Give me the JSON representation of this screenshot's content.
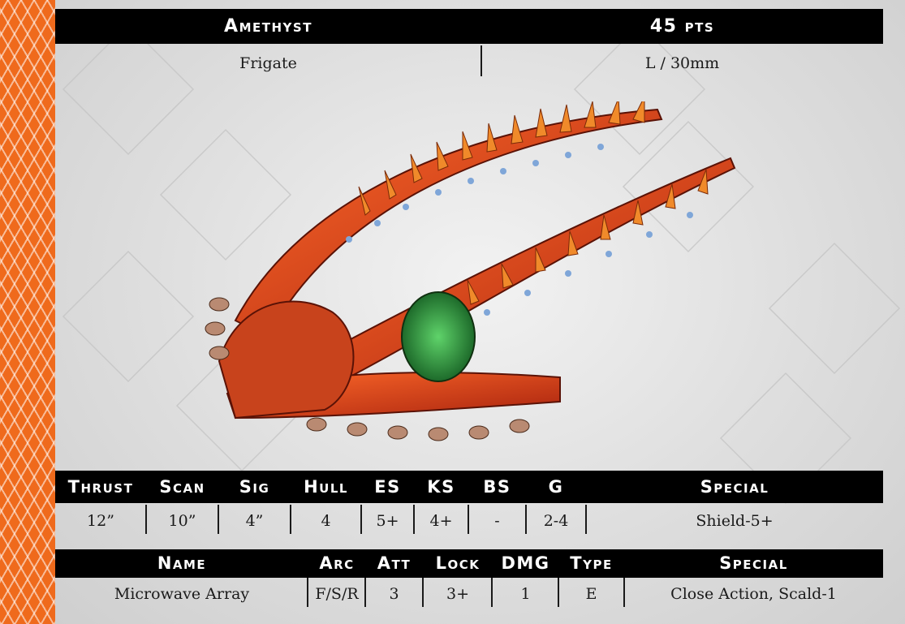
{
  "header": {
    "name": "Amethyst",
    "points": "45 pts",
    "class": "Frigate",
    "size": "L / 30mm"
  },
  "stats": {
    "headers": [
      "Thrust",
      "Scan",
      "Sig",
      "Hull",
      "ES",
      "KS",
      "BS",
      "G",
      "Special"
    ],
    "values": [
      "12”",
      "10”",
      "4”",
      "4",
      "5+",
      "4+",
      "-",
      "2-4",
      "Shield-5+"
    ]
  },
  "weapons": {
    "headers": [
      "Name",
      "Arc",
      "Att",
      "Lock",
      "DMG",
      "Type",
      "Special"
    ],
    "rows": [
      {
        "name": "Microwave Array",
        "arc": "F/S/R",
        "att": "3",
        "lock": "3+",
        "dmg": "1",
        "type": "E",
        "special": "Close Action, Scald-1"
      }
    ]
  },
  "colors": {
    "accent": "#ef6a1c",
    "bar": "#000000",
    "ship_hull": "#d8401c",
    "ship_spines": "#f08a2a"
  }
}
